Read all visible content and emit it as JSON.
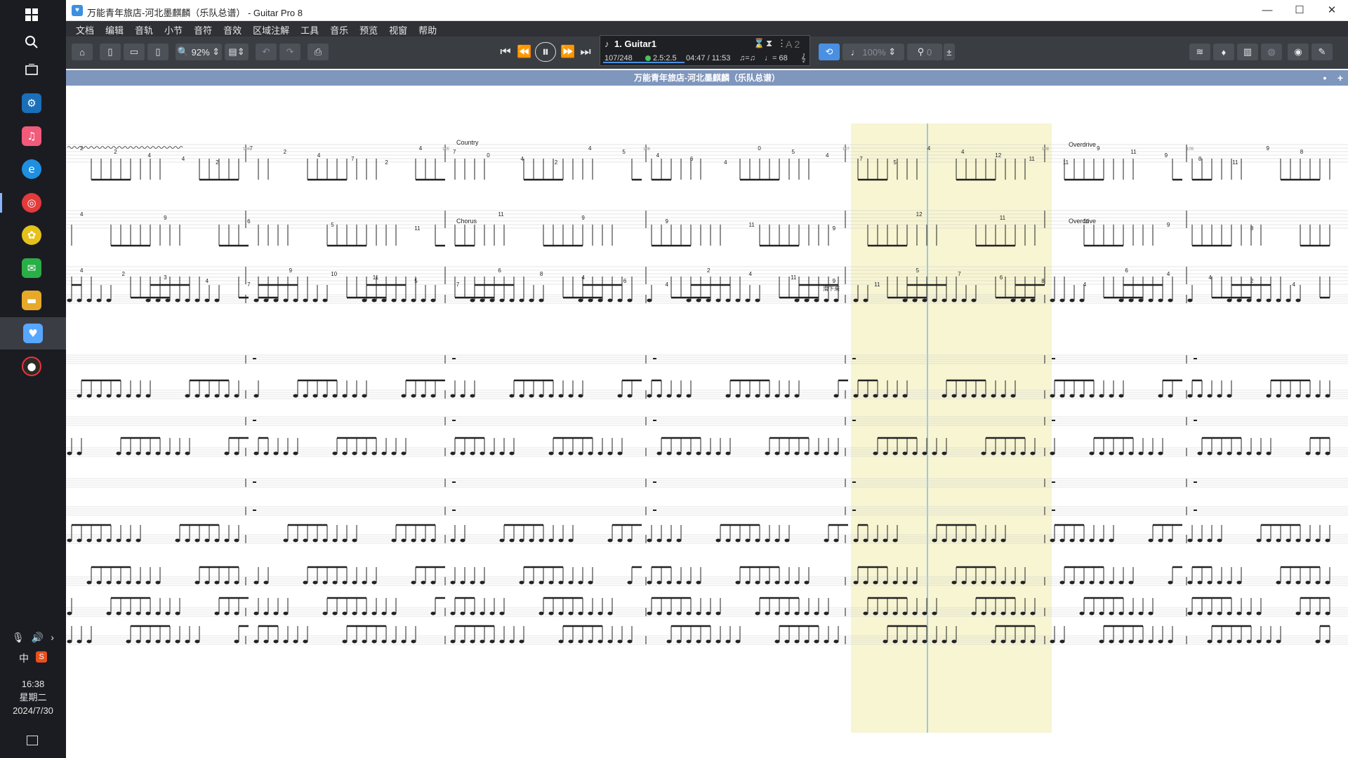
{
  "window": {
    "title": "万能青年旅店-河北墨麒麟（乐队总谱） - Guitar Pro 8",
    "minimize": "—",
    "maximize": "☐",
    "close": "✕"
  },
  "menu": [
    "文档",
    "编辑",
    "音轨",
    "小节",
    "音符",
    "音效",
    "区域注解",
    "工具",
    "音乐",
    "预览",
    "视窗",
    "帮助"
  ],
  "toolbar": {
    "zoom": "92%",
    "speed": "100%",
    "pitch": "0"
  },
  "lcd": {
    "track_name": "1. Guitar1",
    "bar_position": "107/248",
    "time_signature_marker": "2.5:2.5",
    "time": "04:47 / 11:53",
    "tempo": "♩= 68",
    "key": "A 2"
  },
  "document": {
    "header_title": "万能青年旅店-河北墨麒麟（乐队总谱）"
  },
  "score": {
    "bar_numbers": [
      "104",
      "105",
      "106",
      "107",
      "108",
      "109"
    ],
    "annotations": {
      "country": "Country",
      "chorus": "Chorus",
      "overdrive_1": "Overdrive",
      "overdrive_2": "Overdrive",
      "slide_text": "滑下來"
    },
    "tab_numbers_row1": [
      "2",
      "2",
      "4",
      "4",
      "2",
      "7",
      "2",
      "4",
      "7",
      "2",
      "4",
      "7",
      "0",
      "4",
      "2",
      "4",
      "5",
      "4",
      "6",
      "4",
      "0",
      "5",
      "4",
      "7",
      "5",
      "4",
      "4",
      "12",
      "11",
      "11",
      "9",
      "11",
      "9",
      "8",
      "11",
      "9",
      "8"
    ],
    "tab_numbers_row2": [
      "4",
      "9",
      "6",
      "5",
      "11",
      "11",
      "9",
      "9",
      "11",
      "9",
      "12",
      "11",
      "11",
      "9",
      "8"
    ],
    "tab_numbers_row3": [
      "4",
      "2",
      "3",
      "4",
      "7",
      "9",
      "10",
      "11",
      "5",
      "7",
      "6",
      "8",
      "4",
      "6",
      "4",
      "2",
      "4",
      "11",
      "9",
      "11",
      "5",
      "7",
      "6",
      "8",
      "4",
      "6",
      "4",
      "4",
      "2",
      "4"
    ]
  },
  "taskbar": {
    "ime": "中",
    "time": "16:38",
    "weekday": "星期二",
    "date": "2024/7/30"
  },
  "colors": {
    "loop_highlight": "#f7f5d2",
    "playhead": "#9cc7e8",
    "header_bar": "#7f96bd",
    "accent": "#4a90e2"
  }
}
